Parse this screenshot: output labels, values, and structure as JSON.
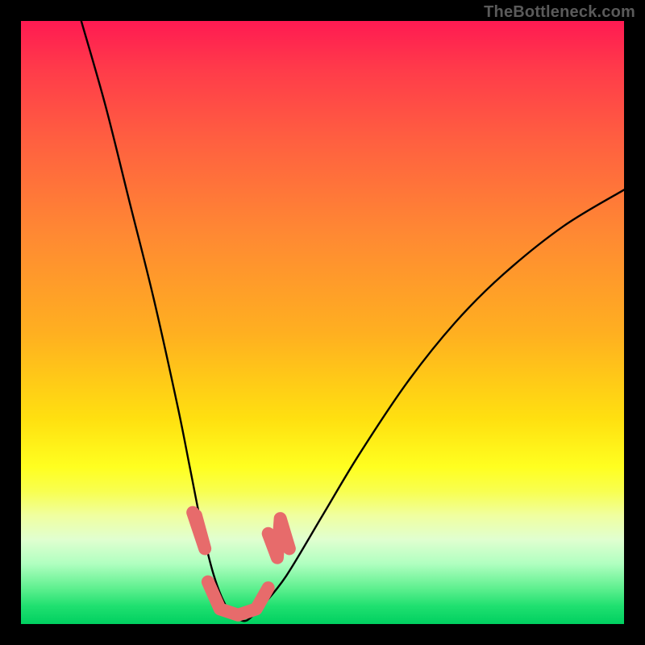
{
  "watermark": {
    "text": "TheBottleneck.com"
  },
  "chart_data": {
    "type": "line",
    "title": "",
    "xlabel": "",
    "ylabel": "",
    "xlim": [
      0,
      100
    ],
    "ylim": [
      0,
      100
    ],
    "grid": false,
    "series": [
      {
        "name": "bottleneck-curve",
        "x": [
          10,
          14,
          18,
          22,
          26,
          28,
          30,
          32,
          34,
          36,
          37,
          38,
          40,
          44,
          50,
          56,
          64,
          72,
          80,
          90,
          100
        ],
        "y": [
          100,
          86,
          70,
          54,
          36,
          26,
          16,
          8,
          3,
          1,
          0.5,
          1,
          3,
          8,
          18,
          28,
          40,
          50,
          58,
          66,
          72
        ]
      }
    ],
    "markers": [
      {
        "name": "paint-left-stroke",
        "path": [
          [
            28.5,
            18.5
          ],
          [
            30.5,
            12.5
          ],
          [
            29.0,
            18.0
          ]
        ]
      },
      {
        "name": "paint-right-stroke",
        "path": [
          [
            41.0,
            15.0
          ],
          [
            42.5,
            11.0
          ],
          [
            43.0,
            17.5
          ],
          [
            44.5,
            12.5
          ]
        ]
      },
      {
        "name": "paint-bottom-arc",
        "path": [
          [
            31.0,
            7.0
          ],
          [
            33.0,
            2.5
          ],
          [
            36.0,
            1.5
          ],
          [
            39.0,
            2.5
          ],
          [
            41.0,
            6.0
          ]
        ]
      }
    ],
    "colors": {
      "curve": "#000000",
      "paint": "#e76b6b"
    }
  }
}
